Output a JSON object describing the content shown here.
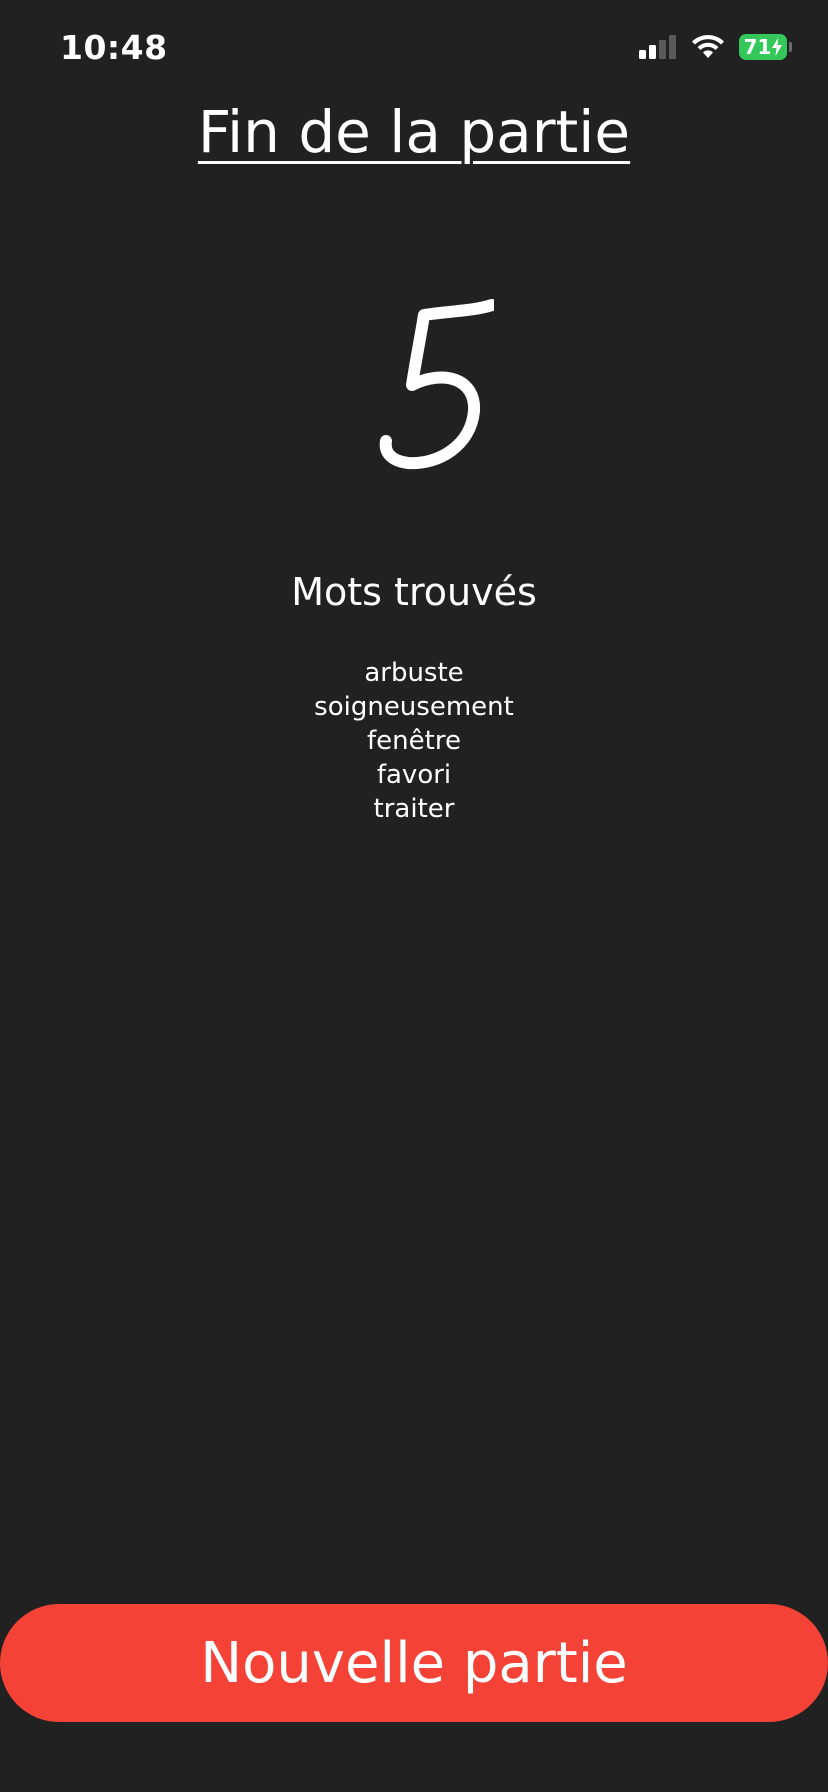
{
  "status_bar": {
    "time": "10:48",
    "battery_level": "71",
    "battery_color": "#34c759",
    "signal_icon": "cellular-signal-icon",
    "wifi_icon": "wifi-icon"
  },
  "title": "Fin de la partie",
  "score": "5",
  "found_heading": "Mots trouvés",
  "words": [
    "arbuste",
    "soigneusement",
    "fenêtre",
    "favori",
    "traiter"
  ],
  "new_game_label": "Nouvelle partie",
  "colors": {
    "background": "#212121",
    "accent": "#f44336",
    "text": "#ffffff"
  }
}
